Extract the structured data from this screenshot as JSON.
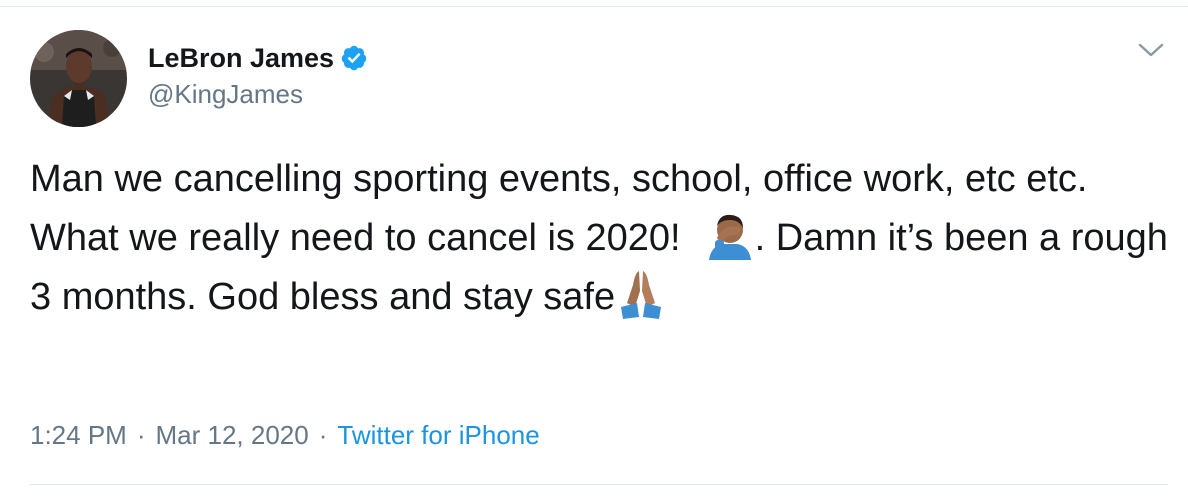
{
  "tweet": {
    "author": {
      "display_name": "LeBron James",
      "handle": "@KingJames",
      "verified": true,
      "avatar_icon": "profile-photo"
    },
    "text_parts": {
      "part1": "Man we cancelling sporting events, school, office work, etc etc. What we really need to cancel is 2020!",
      "emoji1": "man-facepalming-emoji",
      "part2": ". Damn it’s been a rough 3 months. God bless and stay safe",
      "emoji2": "folded-hands-emoji"
    },
    "meta": {
      "time": "1:24 PM",
      "separator1": "·",
      "date": "Mar 12, 2020",
      "separator2": "·",
      "source": "Twitter for iPhone"
    },
    "menu_icon": "chevron-down-icon"
  },
  "colors": {
    "text": "#14171a",
    "secondary": "#657786",
    "link": "#1b95e0",
    "verified": "#1da1f2",
    "border": "#e1e8ed"
  }
}
